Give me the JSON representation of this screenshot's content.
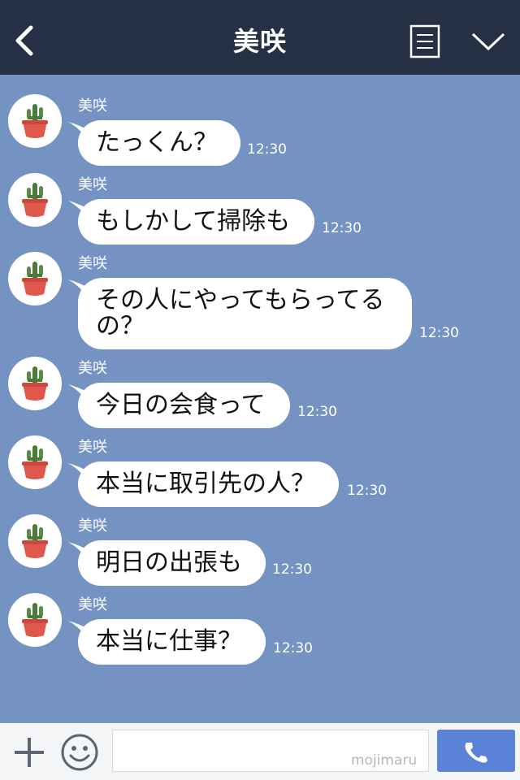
{
  "header": {
    "title": "美咲"
  },
  "icons": {
    "back": "chevron-left-icon",
    "menu": "menu-list-icon",
    "collapse": "chevron-down-icon",
    "plus": "plus-icon",
    "emoji": "smiley-icon",
    "call": "phone-icon"
  },
  "colors": {
    "header_bg": "#253045",
    "chat_bg": "#7493c3",
    "bubble_bg": "#ffffff",
    "call_button": "#5a83d8"
  },
  "messages": [
    {
      "sender": "美咲",
      "text": "たっくん？",
      "time": "12:30"
    },
    {
      "sender": "美咲",
      "text": "もしかして掃除も",
      "time": "12:30"
    },
    {
      "sender": "美咲",
      "text_line1": "その人にやってもらってる",
      "text_line2": "の？",
      "time": "12:30"
    },
    {
      "sender": "美咲",
      "text": "今日の会食って",
      "time": "12:30"
    },
    {
      "sender": "美咲",
      "text": "本当に取引先の人？",
      "time": "12:30"
    },
    {
      "sender": "美咲",
      "text": "明日の出張も",
      "time": "12:30"
    },
    {
      "sender": "美咲",
      "text": "本当に仕事？",
      "time": "12:30"
    }
  ],
  "footer": {
    "watermark": "mojimaru"
  }
}
